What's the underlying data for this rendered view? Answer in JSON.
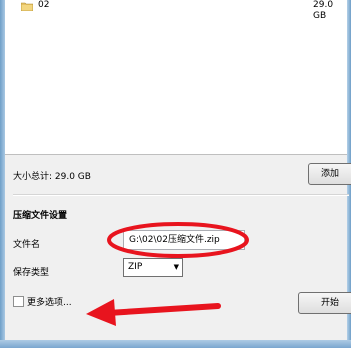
{
  "file_list": {
    "rows": [
      {
        "icon": "folder-icon",
        "name": "02",
        "size": "29.0 GB"
      }
    ]
  },
  "summary": {
    "total_label": "大小总计: 29.0 GB",
    "add_button_label": "添加"
  },
  "compression_settings": {
    "section_title": "压缩文件设置",
    "filename_label": "文件名",
    "filename_value": "G:\\02\\02压缩文件.zip",
    "save_type_label": "保存类型",
    "save_type_value": "ZIP"
  },
  "footer": {
    "more_options_label": "更多选项...",
    "more_options_checked": false,
    "start_button_label": "开始"
  },
  "annotations": {
    "ellipse_color": "#e8141e",
    "arrow_color": "#e8141e"
  }
}
